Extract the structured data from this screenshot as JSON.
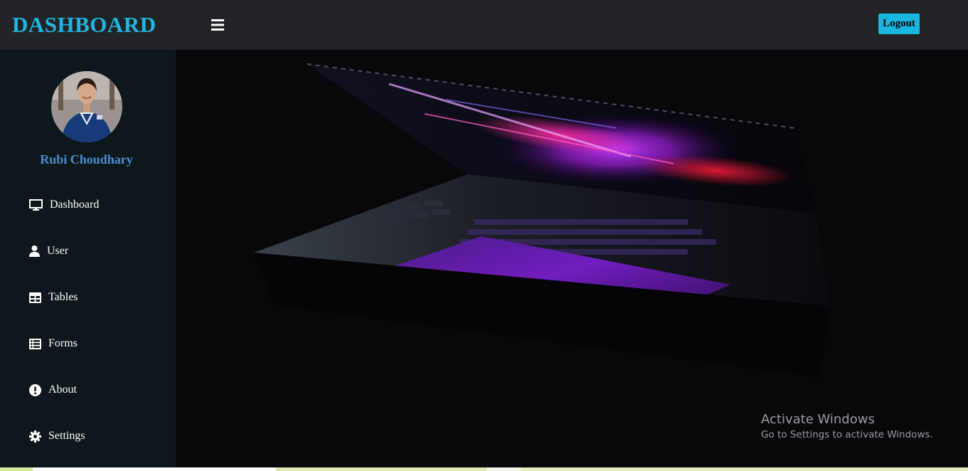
{
  "header": {
    "brand": "DASHBOARD",
    "menu_icon": "hamburger-icon",
    "logout_label": "Logout"
  },
  "sidebar": {
    "user_name": "Rubi Choudhary",
    "items": [
      {
        "label": "Dashboard",
        "icon": "monitor-icon"
      },
      {
        "label": "User",
        "icon": "user-icon"
      },
      {
        "label": "Tables",
        "icon": "table-icon"
      },
      {
        "label": "Forms",
        "icon": "list-icon"
      },
      {
        "label": "About",
        "icon": "exclamation-circle-icon"
      },
      {
        "label": "Settings",
        "icon": "gear-icon"
      }
    ]
  },
  "watermark": {
    "title": "Activate Windows",
    "subtitle": "Go to Settings to activate Windows."
  },
  "colors": {
    "accent": "#1fb5e0",
    "header_bg": "#222327",
    "sidebar_bg": "#0e171b",
    "username": "#4a8fd0"
  }
}
